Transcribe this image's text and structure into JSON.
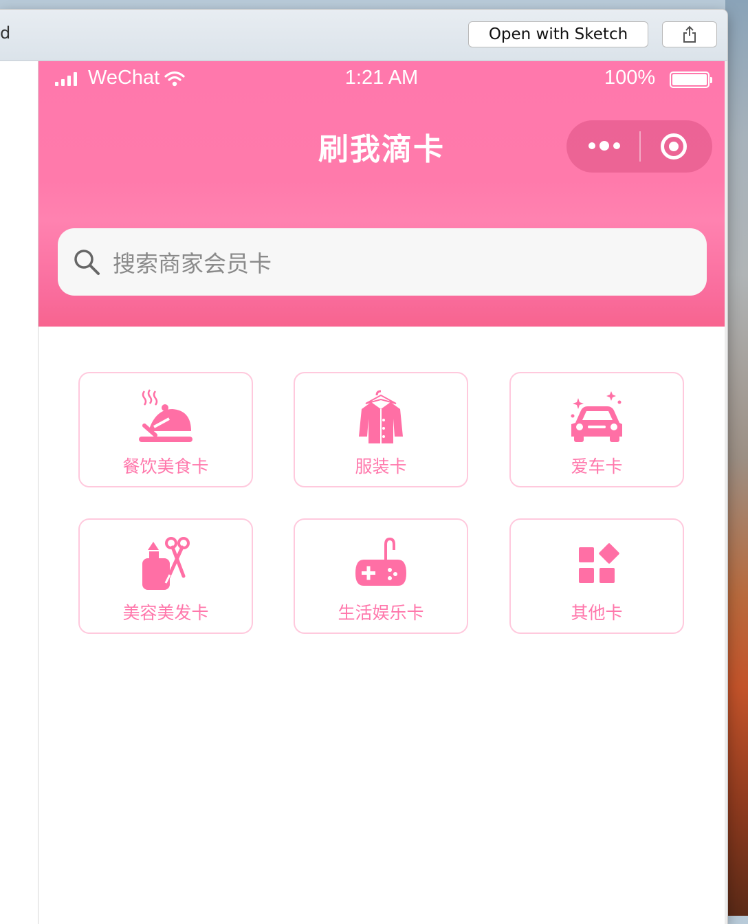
{
  "toolbar": {
    "left_text": "d",
    "open_button_label": "Open with Sketch",
    "share_icon": "share-icon"
  },
  "status_bar": {
    "carrier": "WeChat",
    "time": "1:21 AM",
    "battery_percent": "100%"
  },
  "header": {
    "title": "刷我滴卡",
    "capsule_icons": [
      "more-dots-icon",
      "close-target-icon"
    ]
  },
  "search": {
    "placeholder": "搜索商家会员卡"
  },
  "categories": [
    {
      "label": "餐饮美食卡",
      "icon": "food-cloche-icon"
    },
    {
      "label": "服装卡",
      "icon": "clothing-icon"
    },
    {
      "label": "爱车卡",
      "icon": "car-icon"
    },
    {
      "label": "美容美发卡",
      "icon": "beauty-scissors-icon"
    },
    {
      "label": "生活娱乐卡",
      "icon": "gamepad-icon"
    },
    {
      "label": "其他卡",
      "icon": "apps-grid-icon"
    }
  ],
  "colors": {
    "brand_pink": "#ff78ac",
    "card_border": "#ffc9dd",
    "label_pink": "#ff77ab"
  }
}
